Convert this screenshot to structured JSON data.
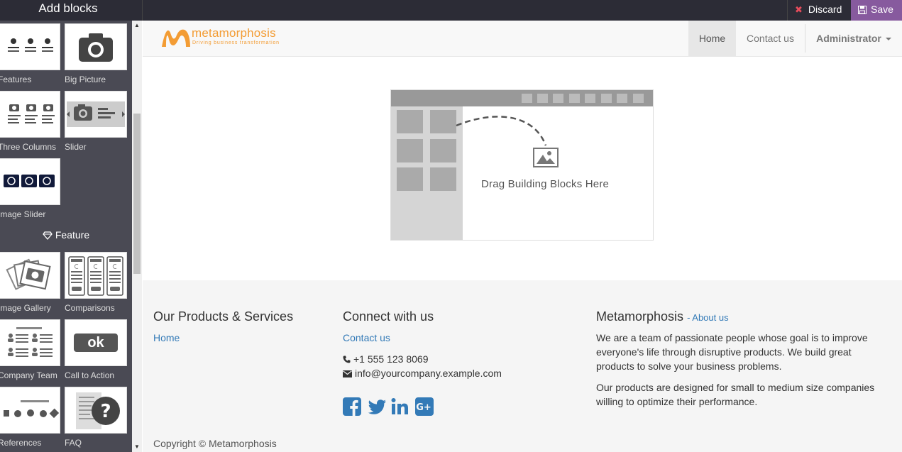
{
  "editor": {
    "panel_title": "Add blocks",
    "discard_label": "Discard",
    "save_label": "Save"
  },
  "snippets": {
    "row1": [
      "Features",
      "Big Picture"
    ],
    "row2": [
      "Three Columns",
      "Slider"
    ],
    "row3": [
      "Image Slider"
    ],
    "section_feature": "Feature",
    "row4": [
      "Image Gallery",
      "Comparisons"
    ],
    "row5": [
      "Company Team",
      "Call to Action"
    ],
    "row6": [
      "References",
      "FAQ"
    ],
    "cta_thumb_text": "ok"
  },
  "site": {
    "logo_name": "metamorphosis",
    "logo_tagline": "Driving business transformation",
    "nav": {
      "home": "Home",
      "contact": "Contact us",
      "user": "Administrator"
    },
    "dropzone_text": "Drag Building Blocks Here"
  },
  "footer": {
    "col1": {
      "heading": "Our Products & Services",
      "link": "Home"
    },
    "col2": {
      "heading": "Connect with us",
      "link": "Contact us",
      "phone": "+1 555 123 8069",
      "email": "info@yourcompany.example.com"
    },
    "col3": {
      "heading": "Metamorphosis",
      "about": "- About us",
      "p1": "We are a team of passionate people whose goal is to improve everyone's life through disruptive products. We build great products to solve your business problems.",
      "p2": "Our products are designed for small to medium size companies willing to optimize their performance."
    },
    "copyright": "Copyright © Metamorphosis"
  },
  "colors": {
    "topbar": "#2c2c36",
    "save": "#875a9e",
    "link": "#337ab7",
    "logo_orange": "#f39c34"
  }
}
